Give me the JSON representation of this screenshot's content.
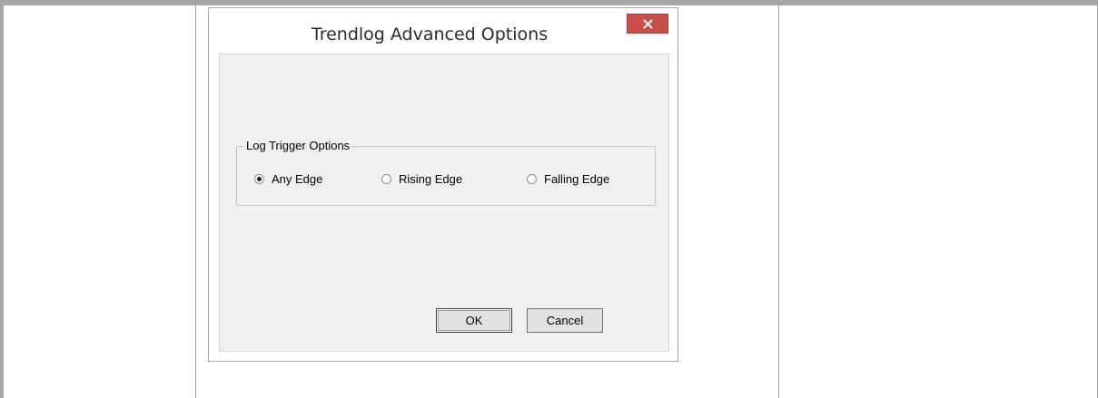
{
  "dialog": {
    "title": "Trendlog Advanced Options",
    "close_icon": "close-icon"
  },
  "group": {
    "legend": "Log Trigger Options",
    "options": [
      {
        "label": "Any Edge",
        "selected": true
      },
      {
        "label": "Rising Edge",
        "selected": false
      },
      {
        "label": "Falling Edge",
        "selected": false
      }
    ]
  },
  "buttons": {
    "ok_label": "OK",
    "cancel_label": "Cancel"
  },
  "colors": {
    "close_button": "#c7504a",
    "client_background": "#f0f0f0"
  }
}
